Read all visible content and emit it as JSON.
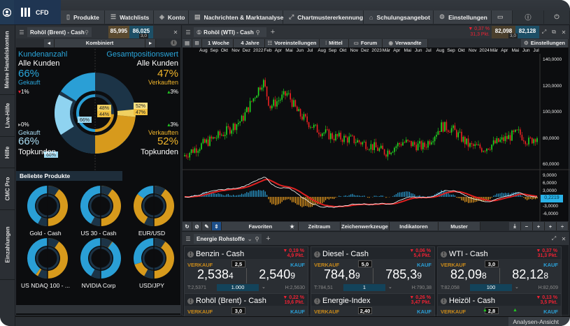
{
  "app": {
    "brand": "CFD"
  },
  "nav": [
    {
      "label": "Produkte",
      "icon": "book-icon"
    },
    {
      "label": "Watchlists",
      "icon": "list-icon"
    },
    {
      "label": "Konto",
      "icon": "tag-icon"
    },
    {
      "label": "Nachrichten & Marktanalysen",
      "icon": "news-icon"
    },
    {
      "label": "Chartmustererkennung",
      "icon": "pattern-icon"
    },
    {
      "label": "Schulungsangebot",
      "icon": "graduation-cap-icon"
    },
    {
      "label": "Einstellungen",
      "icon": "gear-icon"
    }
  ],
  "sidetabs": [
    "Meine Handelskonten",
    "Live-Hilfe",
    "Hilfe",
    "CMC Pro",
    "Einzahlungen"
  ],
  "left_panel": {
    "instrument": "Rohöl (Brent) - Cash",
    "sell": "85,995",
    "buy": "86,025",
    "spread": "3,0",
    "mode": "Kombiniert",
    "sentiment": {
      "left_title": "Kundenanzahl",
      "right_title": "Gesamtpositionswert",
      "all_left": "Alle Kunden",
      "all_left_pct": "66%",
      "all_left_side": "Gekauft",
      "all_left_chg": "1%",
      "top_left_chg": "0%",
      "top_left_side": "Gekauft",
      "top_left_pct": "66%",
      "top_left": "Topkunden",
      "all_right": "Alle Kunden",
      "all_right_pct": "47%",
      "all_right_side": "Verkauften",
      "all_right_chg": "3%",
      "top_right_chg": "3%",
      "top_right_side": "Verkauften",
      "top_right_pct": "52%",
      "top_right": "Topkunden",
      "tags": {
        "inner_blue": "66%",
        "outer_blue": "66%",
        "inner_y1": "48%",
        "inner_y2": "44%",
        "outer_y1": "52%",
        "outer_y2": "47%"
      },
      "colors": {
        "buy": "#2aa5da",
        "sell": "#f0b42a"
      }
    },
    "popular_title": "Beliebte Produkte",
    "popular": [
      {
        "name": "Gold - Cash",
        "buy": 0.45
      },
      {
        "name": "US 30 - Cash",
        "buy": 0.42
      },
      {
        "name": "EUR/USD",
        "buy": 0.15
      },
      {
        "name": "US NDAQ 100 - ...",
        "buy": 0.4
      },
      {
        "name": "NVIDIA Corp",
        "buy": 0.9
      },
      {
        "name": "USD/JPY",
        "buy": 0.3
      }
    ]
  },
  "chart": {
    "instrument": "Rohöl (WTI) - Cash",
    "change_pct": "▼ 0,37 %",
    "change_pts": "31,3 Pkt.",
    "sell": "82,098",
    "buy": "82,128",
    "spread": "3,0",
    "toolbar": [
      "1 Woche",
      "4 Jahre",
      "Voreinstellungen",
      "Mittel",
      "Forum",
      "Verwandte",
      "Einstellungen"
    ],
    "months": [
      "Aug",
      "Sep",
      "Okt",
      "Nov",
      "Dez",
      "2022",
      "Feb",
      "Apr",
      "Mai",
      "Jun",
      "Jul",
      "Aug",
      "Sep",
      "Okt",
      "Nov",
      "Dez",
      "2023",
      "Mär",
      "Apr",
      "Mai",
      "Jun",
      "Jul",
      "Aug",
      "Sep",
      "Okt",
      "Nov",
      "2024",
      "Mär",
      "Apr",
      "Mai",
      "Jun",
      "Jul"
    ],
    "price_axis": [
      "140,0000",
      "120,0000",
      "100,0000",
      "80,0000",
      "60,0000"
    ],
    "macd_axis": [
      "9,0000",
      "6,0000",
      "3,0000",
      "-3,0000",
      "-6,0000"
    ],
    "macd_value": "0,2219",
    "bottom_toolbar": [
      "Favoriten",
      "Zeitraum",
      "Zeichenwerkzeuge",
      "Indikatoren",
      "Muster"
    ]
  },
  "watchlist": {
    "title": "Energie Rohstoffe",
    "sell_label": "VERKAUF",
    "buy_label": "KAUF",
    "tiles": [
      {
        "name": "Benzin - Cash",
        "pct": "▼ 0,19 %",
        "pts": "4,9 Pkt.",
        "spread": "2,5",
        "sell": "2,538",
        "sell_s": "4",
        "buy": "2,540",
        "buy_s": "9",
        "low": "T:2,5371",
        "qty": "1.000",
        "high": "H:2,5630"
      },
      {
        "name": "Diesel - Cash",
        "pct": "▼ 0,06 %",
        "pts": "5,4 Pkt.",
        "spread": "5,0",
        "sell": "784,8",
        "sell_s": "9",
        "buy": "785,3",
        "buy_s": "9",
        "low": "T:784,51",
        "qty": "1",
        "high": "H:790,38"
      },
      {
        "name": "WTI - Cash",
        "pct": "▼ 0,37 %",
        "pts": "31,3 Pkt.",
        "spread": "3,0",
        "sell": "82,09",
        "sell_s": "8",
        "buy": "82,12",
        "buy_s": "8",
        "low": "T:82,058",
        "qty": "100",
        "high": "H:82,609"
      },
      {
        "name": "Rohöl (Brent) - Cash",
        "pct": "▼ 0,22 %",
        "pts": "19,6 Pkt.",
        "spread": "3,0"
      },
      {
        "name": "Energie-Index",
        "pct": "▼ 0,26 %",
        "pts": "3,47 Pkt.",
        "spread": "2,40"
      },
      {
        "name": "Heizöl - Cash",
        "pct": "▼ 0,13 %",
        "pts": "3,5 Pkt.",
        "spread": "2,8"
      }
    ]
  },
  "status": {
    "view": "Analysen-Ansicht"
  }
}
